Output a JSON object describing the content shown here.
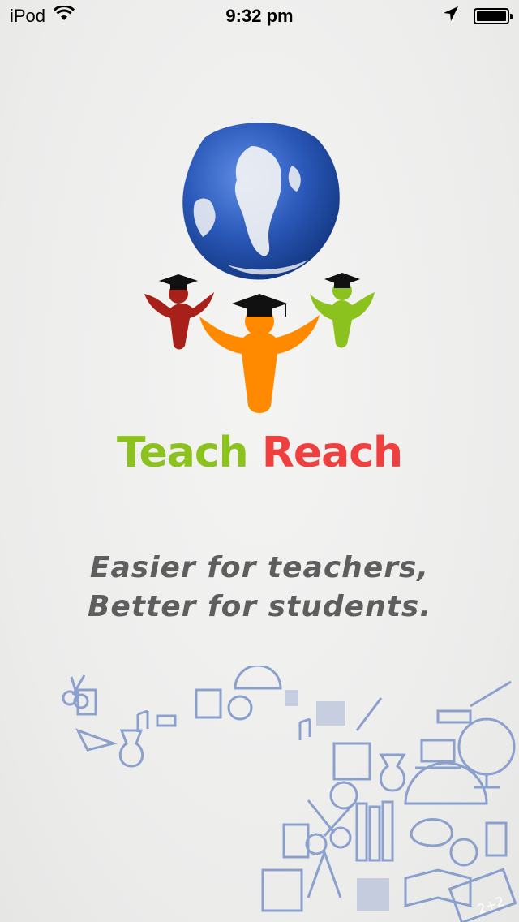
{
  "status_bar": {
    "carrier": "iPod",
    "time": "9:32 pm",
    "icons": [
      "wifi-icon",
      "location-arrow-icon",
      "battery-icon"
    ]
  },
  "brand": {
    "word1": "Teach",
    "word2": "Reach",
    "color_word1": "#8cc21d",
    "color_word2": "#ef3f3f"
  },
  "tagline": {
    "line1": "Easier for teachers,",
    "line2": "Better for students."
  },
  "colors": {
    "background": "#f0f0ef",
    "globe": "#2f5fc0",
    "figure_red": "#a8201a",
    "figure_orange": "#ff8a00",
    "figure_green": "#8cc21d",
    "doodle": "#7b93c8"
  }
}
